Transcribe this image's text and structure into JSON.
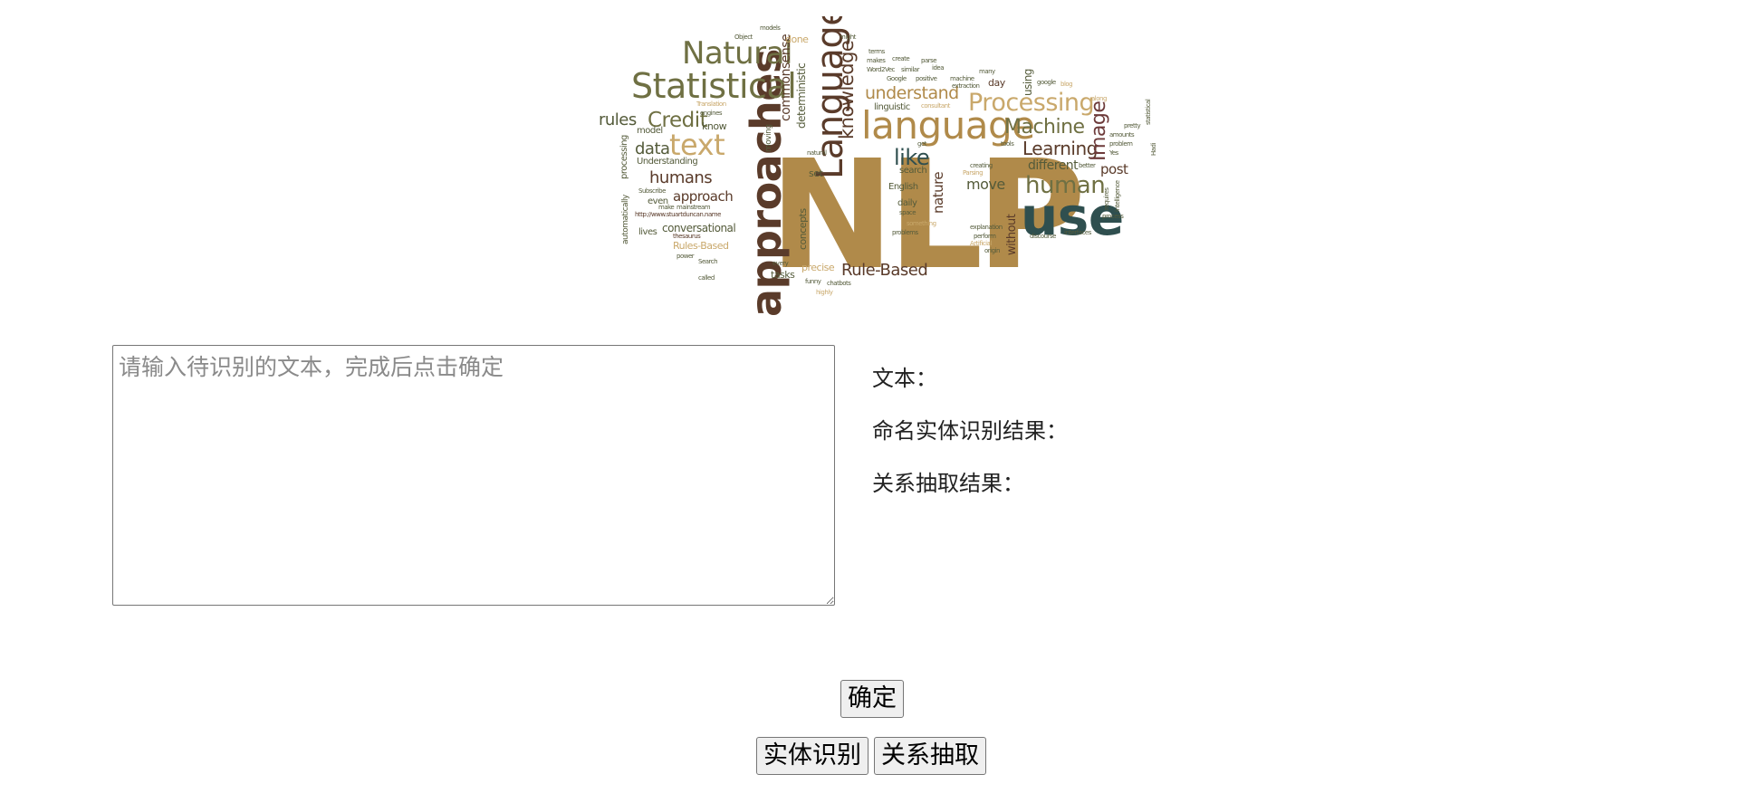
{
  "banner": {
    "alt": "NLP word cloud",
    "palette": {
      "gold": "#b08a4a",
      "olive": "#6f7043",
      "brown": "#5a3b2a",
      "teal": "#2f4f4f",
      "tan": "#c9a86b",
      "darkolive": "#545b3a",
      "wine": "#6d3a3a"
    },
    "words": [
      "NLP",
      "use",
      "approaches",
      "language",
      "Language",
      "Statistical",
      "Natural",
      "Processing",
      "Machine",
      "human",
      "text",
      "Credit",
      "knowledge",
      "Learning",
      "understand",
      "like",
      "Image",
      "Rule-Based",
      "rules",
      "data",
      "humans",
      "approach",
      "conversational",
      "commonsense",
      "deterministic",
      "different",
      "post",
      "move",
      "nature",
      "without",
      "using",
      "model",
      "Understanding",
      "Rules-Based",
      "precise",
      "tasks",
      "concepts",
      "search",
      "English",
      "daily",
      "linguistic",
      "moving",
      "done",
      "lives",
      "even",
      "processing",
      "automatically",
      "done",
      "thesaurus",
      "http://www.stuartduncan.name",
      "Word2Vec",
      "Google",
      "positive",
      "machine",
      "day",
      "process",
      "amounts",
      "problem",
      "interfaces",
      "discourse",
      "problems",
      "explanation",
      "perform",
      "origin",
      "scientists",
      "set",
      "funny",
      "chatbots",
      "highly",
      "every",
      "called",
      "Search",
      "power",
      "Subject",
      "mainstream",
      "make",
      "Subscribe",
      "models",
      "might",
      "terms",
      "create",
      "parse",
      "idea",
      "similar",
      "makes",
      "many",
      "google",
      "blog",
      "Object",
      "able",
      "words",
      "translation",
      "new",
      "Parsing",
      "creating",
      "Artificial",
      "intelligence",
      "requires",
      "find",
      "pretty",
      "Data",
      "statistical",
      "Yes",
      "along",
      "natural",
      "get",
      "tools",
      "better",
      "world",
      "inherent",
      "understanding",
      "examples",
      "first",
      "something",
      "space",
      "negative",
      "Verb",
      "consultant",
      "extraction",
      "engines",
      "Translation",
      "know",
      "lied",
      "Hadi"
    ]
  },
  "input": {
    "placeholder": "请输入待识别的文本，完成后点击确定",
    "value": ""
  },
  "results": {
    "text_label": "文本：",
    "ner_label": "命名实体识别结果：",
    "re_label": "关系抽取结果："
  },
  "buttons": {
    "confirm": "确定",
    "ner": "实体识别",
    "re": "关系抽取"
  }
}
